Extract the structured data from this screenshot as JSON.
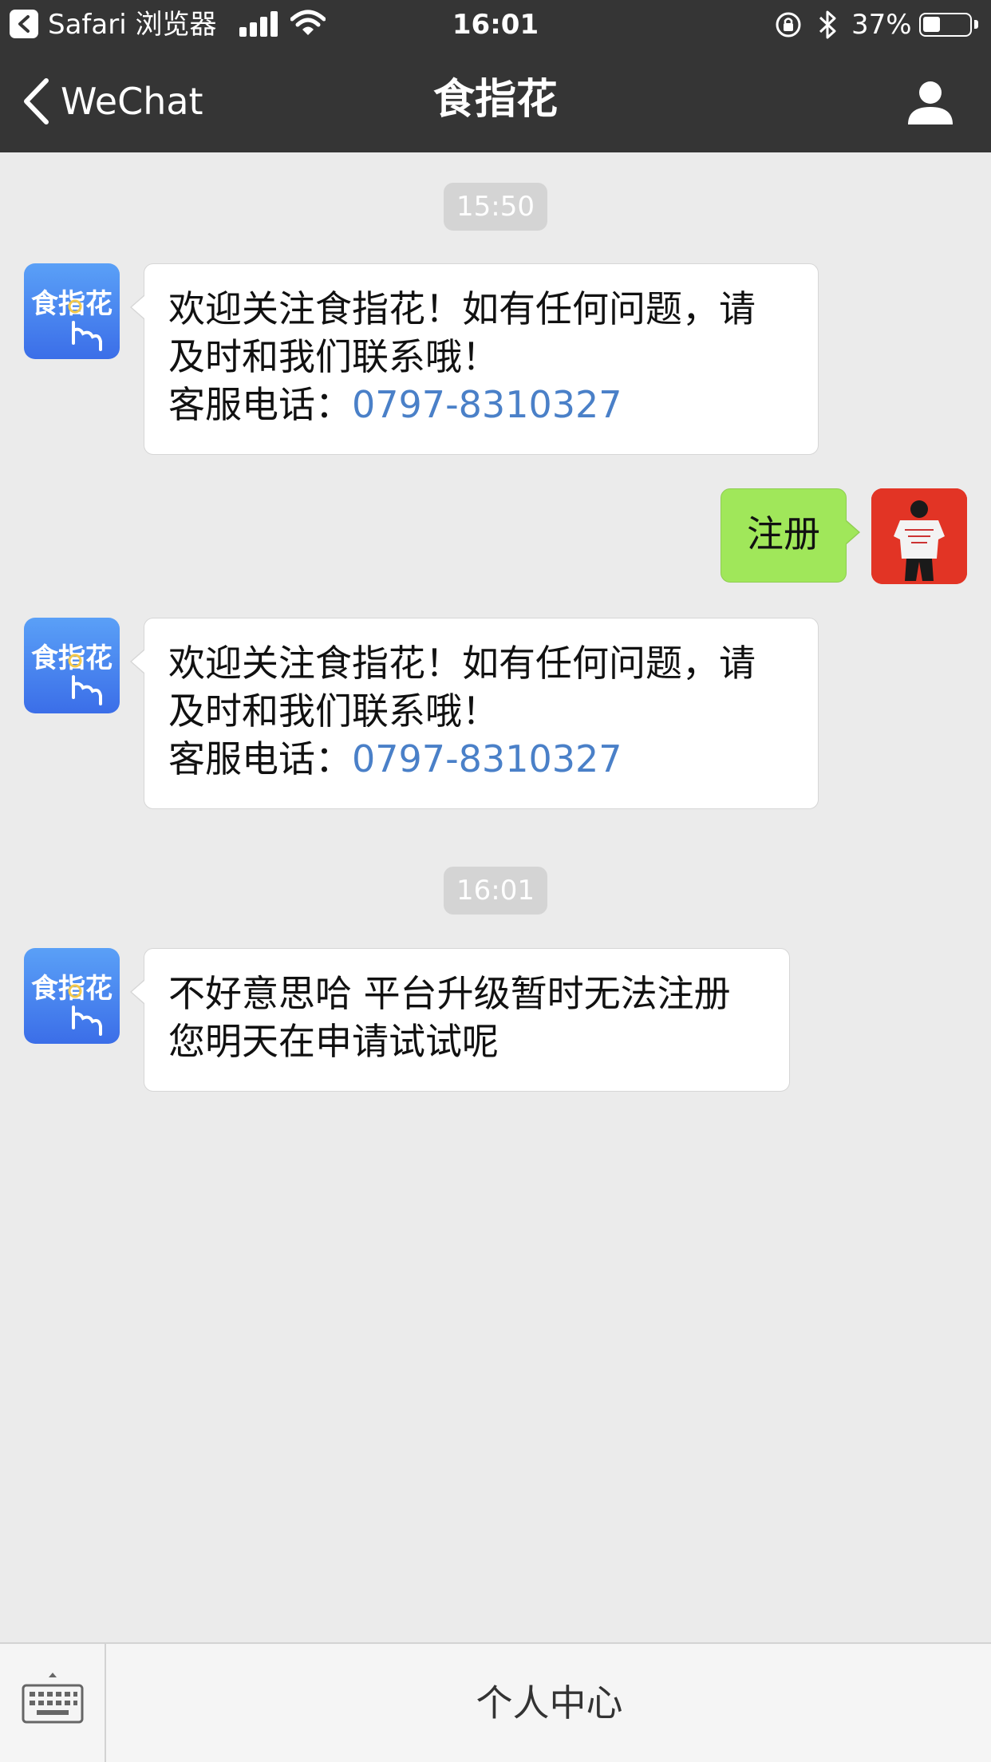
{
  "status_bar": {
    "back_app": "Safari 浏览器",
    "time": "16:01",
    "battery": "37%",
    "battery_level": 0.37
  },
  "nav": {
    "back_label": "WeChat",
    "title": "食指花",
    "profile_icon": "person-icon"
  },
  "account": {
    "avatar_text": "食指花",
    "avatar_icon": "pointing-hand-icon"
  },
  "messages": [
    {
      "type": "timestamp",
      "text": "15:50"
    },
    {
      "type": "incoming",
      "line1": "欢迎关注食指花！如有任何问题，请",
      "line2": "及时和我们联系哦！",
      "phone_label": "客服电话：",
      "phone": "0797-8310327"
    },
    {
      "type": "outgoing",
      "text": "注册"
    },
    {
      "type": "incoming",
      "line1": "欢迎关注食指花！如有任何问题，请",
      "line2": "及时和我们联系哦！",
      "phone_label": "客服电话：",
      "phone": "0797-8310327"
    },
    {
      "type": "timestamp",
      "text": "16:01"
    },
    {
      "type": "incoming",
      "line1": "不好意思哈 平台升级暂时无法注册",
      "line2": "您明天在申请试试呢"
    }
  ],
  "bottom": {
    "keyboard_icon": "keyboard-icon",
    "menu_label": "个人中心"
  },
  "colors": {
    "header_bg": "#353535",
    "chat_bg": "#ebebeb",
    "outgoing_bubble": "#a0e75a",
    "link": "#4a80c8",
    "user_avatar_bg": "#e23425"
  }
}
